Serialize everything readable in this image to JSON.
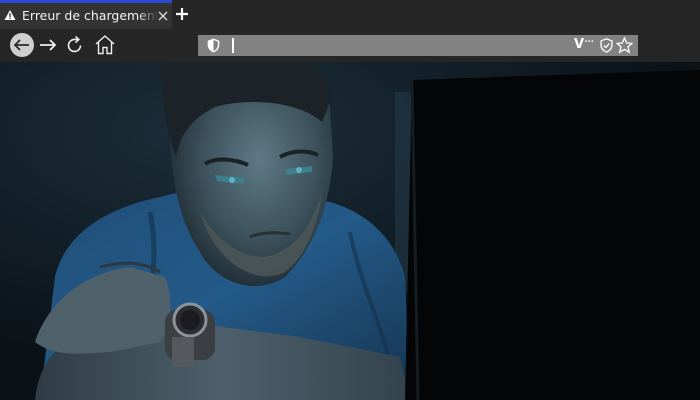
{
  "tab": {
    "title": "Erreur de chargement de la page"
  },
  "urlbar": {
    "value": "",
    "placeholder": ""
  }
}
